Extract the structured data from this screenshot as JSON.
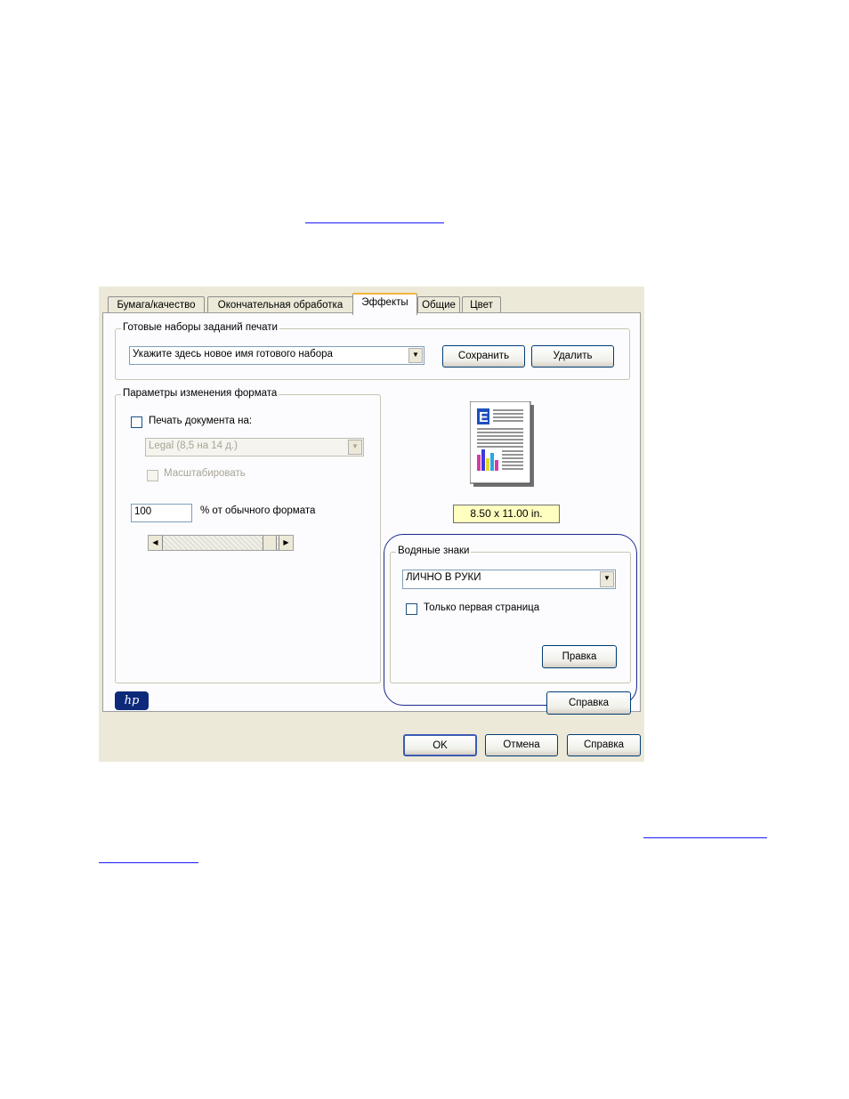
{
  "tabs": [
    "Бумага/качество",
    "Окончательная обработка",
    "Эффекты",
    "Общие",
    "Цвет"
  ],
  "presets": {
    "label": "Готовые наборы заданий печати",
    "combo_value": "Укажите здесь новое имя готового набора",
    "save_label": "Сохранить",
    "delete_label": "Удалить"
  },
  "resize": {
    "label": "Параметры изменения формата",
    "print_on_label": "Печать документа на:",
    "paper_value": "Legal (8,5 на 14 д.)",
    "scale_label": "Масштабировать",
    "percent_value": "100",
    "percent_label": "% от обычного формата"
  },
  "preview": {
    "size_label": "8.50 x 11.00 in.",
    "colors": {
      "bar1": "#d43aa8",
      "bar2": "#3a3ae0",
      "bar3": "#e8d62a",
      "bar4": "#28a8e0",
      "letter": "#1f4fbf"
    }
  },
  "watermarks": {
    "label": "Водяные знаки",
    "combo_value": "ЛИЧНО В РУКИ",
    "first_page_label": "Только первая страница",
    "edit_label": "Правка",
    "highlight_color": "#1a2a8c"
  },
  "brand": {
    "logo_text": "hp"
  },
  "help_label": "Справка",
  "footer": {
    "ok_label": "OK",
    "cancel_label": "Отмена",
    "help_label": "Справка"
  }
}
